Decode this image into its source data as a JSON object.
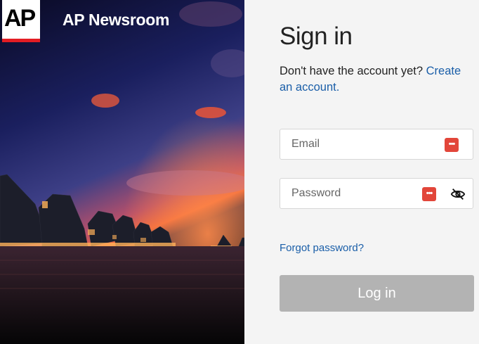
{
  "brand": {
    "logo_text": "AP",
    "name": "AP Newsroom"
  },
  "form": {
    "title": "Sign in",
    "subtitle_text": "Don't have the account yet?",
    "create_link": "Create an account.",
    "email_placeholder": "Email",
    "password_placeholder": "Password",
    "forgot_link": "Forgot password?",
    "login_label": "Log in"
  },
  "icons": {
    "password_manager": "password-manager-icon",
    "toggle_visibility": "eye-slash-icon"
  },
  "colors": {
    "link": "#1a5ea8",
    "button_disabled": "#b3b3b3",
    "logo_accent": "#e31d24",
    "password_manager": "#e2463a"
  }
}
